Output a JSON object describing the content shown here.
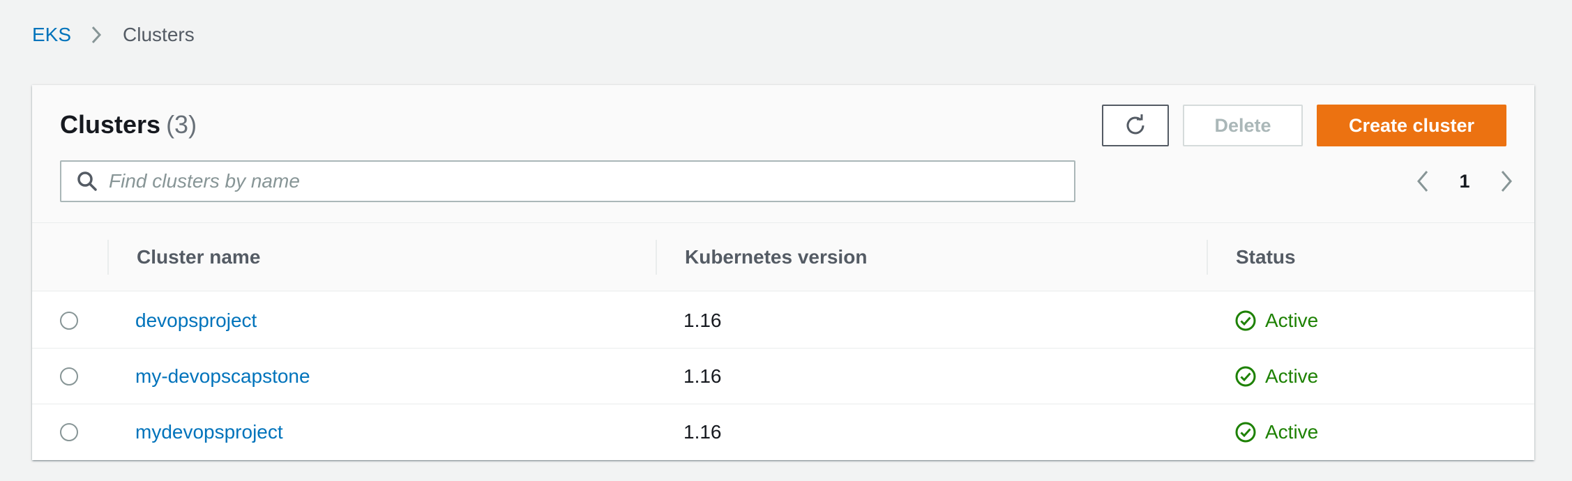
{
  "breadcrumb": {
    "root": "EKS",
    "current": "Clusters"
  },
  "panel": {
    "title": "Clusters",
    "count": "(3)"
  },
  "buttons": {
    "refresh_icon": "refresh-icon",
    "delete": "Delete",
    "create": "Create cluster"
  },
  "search": {
    "placeholder": "Find clusters by name",
    "value": ""
  },
  "pagination": {
    "current_page": "1"
  },
  "table": {
    "columns": [
      "Cluster name",
      "Kubernetes version",
      "Status"
    ],
    "rows": [
      {
        "name": "devopsproject",
        "version": "1.16",
        "status": "Active"
      },
      {
        "name": "my-devopscapstone",
        "version": "1.16",
        "status": "Active"
      },
      {
        "name": "mydevopsproject",
        "version": "1.16",
        "status": "Active"
      }
    ]
  },
  "colors": {
    "link": "#0073bb",
    "primary_button": "#ec7211",
    "status_active": "#1d8102"
  }
}
